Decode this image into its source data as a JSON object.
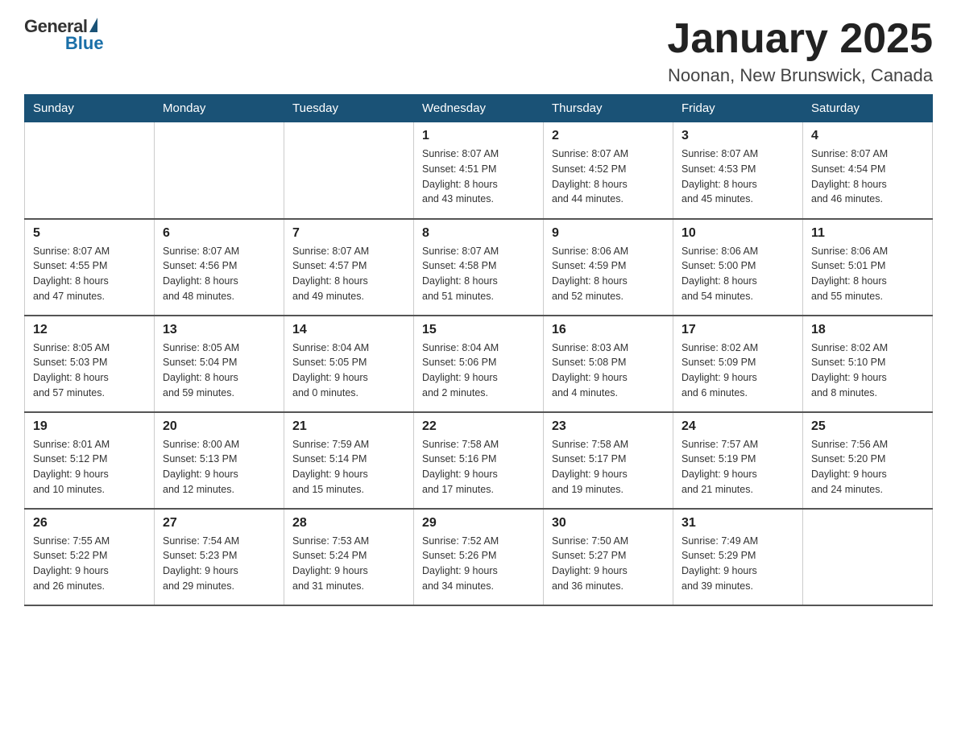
{
  "header": {
    "logo": {
      "general": "General",
      "blue": "Blue"
    },
    "month": "January 2025",
    "location": "Noonan, New Brunswick, Canada"
  },
  "days_of_week": [
    "Sunday",
    "Monday",
    "Tuesday",
    "Wednesday",
    "Thursday",
    "Friday",
    "Saturday"
  ],
  "weeks": [
    [
      {
        "day": "",
        "info": ""
      },
      {
        "day": "",
        "info": ""
      },
      {
        "day": "",
        "info": ""
      },
      {
        "day": "1",
        "info": "Sunrise: 8:07 AM\nSunset: 4:51 PM\nDaylight: 8 hours\nand 43 minutes."
      },
      {
        "day": "2",
        "info": "Sunrise: 8:07 AM\nSunset: 4:52 PM\nDaylight: 8 hours\nand 44 minutes."
      },
      {
        "day": "3",
        "info": "Sunrise: 8:07 AM\nSunset: 4:53 PM\nDaylight: 8 hours\nand 45 minutes."
      },
      {
        "day": "4",
        "info": "Sunrise: 8:07 AM\nSunset: 4:54 PM\nDaylight: 8 hours\nand 46 minutes."
      }
    ],
    [
      {
        "day": "5",
        "info": "Sunrise: 8:07 AM\nSunset: 4:55 PM\nDaylight: 8 hours\nand 47 minutes."
      },
      {
        "day": "6",
        "info": "Sunrise: 8:07 AM\nSunset: 4:56 PM\nDaylight: 8 hours\nand 48 minutes."
      },
      {
        "day": "7",
        "info": "Sunrise: 8:07 AM\nSunset: 4:57 PM\nDaylight: 8 hours\nand 49 minutes."
      },
      {
        "day": "8",
        "info": "Sunrise: 8:07 AM\nSunset: 4:58 PM\nDaylight: 8 hours\nand 51 minutes."
      },
      {
        "day": "9",
        "info": "Sunrise: 8:06 AM\nSunset: 4:59 PM\nDaylight: 8 hours\nand 52 minutes."
      },
      {
        "day": "10",
        "info": "Sunrise: 8:06 AM\nSunset: 5:00 PM\nDaylight: 8 hours\nand 54 minutes."
      },
      {
        "day": "11",
        "info": "Sunrise: 8:06 AM\nSunset: 5:01 PM\nDaylight: 8 hours\nand 55 minutes."
      }
    ],
    [
      {
        "day": "12",
        "info": "Sunrise: 8:05 AM\nSunset: 5:03 PM\nDaylight: 8 hours\nand 57 minutes."
      },
      {
        "day": "13",
        "info": "Sunrise: 8:05 AM\nSunset: 5:04 PM\nDaylight: 8 hours\nand 59 minutes."
      },
      {
        "day": "14",
        "info": "Sunrise: 8:04 AM\nSunset: 5:05 PM\nDaylight: 9 hours\nand 0 minutes."
      },
      {
        "day": "15",
        "info": "Sunrise: 8:04 AM\nSunset: 5:06 PM\nDaylight: 9 hours\nand 2 minutes."
      },
      {
        "day": "16",
        "info": "Sunrise: 8:03 AM\nSunset: 5:08 PM\nDaylight: 9 hours\nand 4 minutes."
      },
      {
        "day": "17",
        "info": "Sunrise: 8:02 AM\nSunset: 5:09 PM\nDaylight: 9 hours\nand 6 minutes."
      },
      {
        "day": "18",
        "info": "Sunrise: 8:02 AM\nSunset: 5:10 PM\nDaylight: 9 hours\nand 8 minutes."
      }
    ],
    [
      {
        "day": "19",
        "info": "Sunrise: 8:01 AM\nSunset: 5:12 PM\nDaylight: 9 hours\nand 10 minutes."
      },
      {
        "day": "20",
        "info": "Sunrise: 8:00 AM\nSunset: 5:13 PM\nDaylight: 9 hours\nand 12 minutes."
      },
      {
        "day": "21",
        "info": "Sunrise: 7:59 AM\nSunset: 5:14 PM\nDaylight: 9 hours\nand 15 minutes."
      },
      {
        "day": "22",
        "info": "Sunrise: 7:58 AM\nSunset: 5:16 PM\nDaylight: 9 hours\nand 17 minutes."
      },
      {
        "day": "23",
        "info": "Sunrise: 7:58 AM\nSunset: 5:17 PM\nDaylight: 9 hours\nand 19 minutes."
      },
      {
        "day": "24",
        "info": "Sunrise: 7:57 AM\nSunset: 5:19 PM\nDaylight: 9 hours\nand 21 minutes."
      },
      {
        "day": "25",
        "info": "Sunrise: 7:56 AM\nSunset: 5:20 PM\nDaylight: 9 hours\nand 24 minutes."
      }
    ],
    [
      {
        "day": "26",
        "info": "Sunrise: 7:55 AM\nSunset: 5:22 PM\nDaylight: 9 hours\nand 26 minutes."
      },
      {
        "day": "27",
        "info": "Sunrise: 7:54 AM\nSunset: 5:23 PM\nDaylight: 9 hours\nand 29 minutes."
      },
      {
        "day": "28",
        "info": "Sunrise: 7:53 AM\nSunset: 5:24 PM\nDaylight: 9 hours\nand 31 minutes."
      },
      {
        "day": "29",
        "info": "Sunrise: 7:52 AM\nSunset: 5:26 PM\nDaylight: 9 hours\nand 34 minutes."
      },
      {
        "day": "30",
        "info": "Sunrise: 7:50 AM\nSunset: 5:27 PM\nDaylight: 9 hours\nand 36 minutes."
      },
      {
        "day": "31",
        "info": "Sunrise: 7:49 AM\nSunset: 5:29 PM\nDaylight: 9 hours\nand 39 minutes."
      },
      {
        "day": "",
        "info": ""
      }
    ]
  ]
}
